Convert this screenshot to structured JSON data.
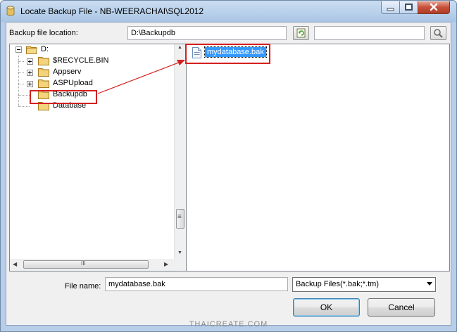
{
  "window": {
    "title": "Locate Backup File - NB-WEERACHAI\\SQL2012",
    "controls": [
      "minimize-icon",
      "maximize-icon",
      "close-icon"
    ]
  },
  "location": {
    "label": "Backup file location:",
    "value": "D:\\Backupdb",
    "refresh_icon": "refresh-icon",
    "search_value": "",
    "search_icon": "search-icon"
  },
  "tree": {
    "root": {
      "label": "D:",
      "expanded": true
    },
    "items": [
      {
        "label": "$RECYCLE.BIN",
        "expander": "plus"
      },
      {
        "label": "Appserv",
        "expander": "plus"
      },
      {
        "label": "ASPUpload",
        "expander": "plus"
      },
      {
        "label": "Backupdb",
        "expander": "none",
        "selected": true
      },
      {
        "label": "Database",
        "expander": "none"
      }
    ]
  },
  "files": [
    {
      "label": "mydatabase.bak",
      "selected": true,
      "icon": "file-icon"
    }
  ],
  "scrollbars": {
    "vertical": {
      "up": "▲",
      "down": "▼",
      "grip": "≡"
    },
    "horizontal": {
      "left": "◀",
      "right": "▶",
      "grip": "III"
    }
  },
  "filename": {
    "label": "File name:",
    "value": "mydatabase.bak"
  },
  "filetype": {
    "selected": "Backup Files(*.bak;*.tm)",
    "dropdown_icon": "chevron-down-icon"
  },
  "buttons": {
    "ok": "OK",
    "cancel": "Cancel"
  },
  "annotation": {
    "color": "#d42020"
  },
  "watermark": "THAICREATE.COM",
  "colors": {
    "selection": "#3399ff",
    "folder": "#e8c063",
    "annotation": "#d42020"
  }
}
